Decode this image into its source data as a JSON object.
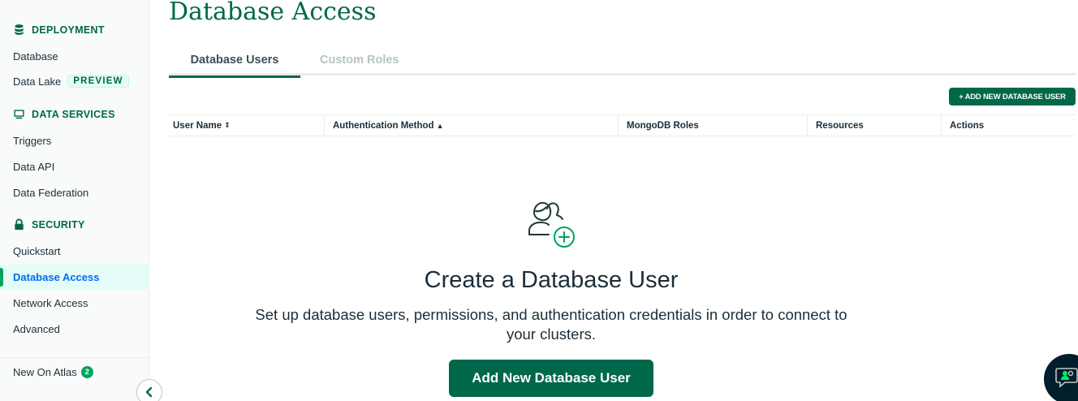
{
  "sidebar": {
    "deployment": {
      "label": "DEPLOYMENT",
      "icon": "database-icon"
    },
    "database": "Database",
    "data_lake": "Data Lake",
    "preview_badge": "PREVIEW",
    "data_services": {
      "label": "DATA SERVICES",
      "icon": "monitor-icon"
    },
    "triggers": "Triggers",
    "data_api": "Data API",
    "data_federation": "Data Federation",
    "security": {
      "label": "SECURITY",
      "icon": "lock-icon"
    },
    "quickstart": "Quickstart",
    "database_access": "Database Access",
    "network_access": "Network Access",
    "advanced": "Advanced",
    "new_on_atlas": "New On Atlas",
    "new_count": "2"
  },
  "page": {
    "title": "Database Access",
    "tabs": [
      {
        "label": "Database Users",
        "active": true
      },
      {
        "label": "Custom Roles",
        "active": false
      }
    ],
    "add_small_label": "ADD NEW DATABASE USER",
    "add_small_prefix": "+"
  },
  "table": {
    "columns": [
      {
        "label": "User Name",
        "sort": "⇕"
      },
      {
        "label": "Authentication Method",
        "sort": "▲"
      },
      {
        "label": "MongoDB Roles"
      },
      {
        "label": "Resources"
      },
      {
        "label": "Actions"
      }
    ]
  },
  "empty_state": {
    "icon": "add-users-icon",
    "title": "Create a Database User",
    "description": "Set up database users, permissions, and authentication credentials in order to connect to your clusters.",
    "button_label": "Add New Database User"
  },
  "colors": {
    "brand_green": "#00684a",
    "accent_green": "#00a35c",
    "active_blue": "#016bf8",
    "dark_navy": "#001e2b"
  }
}
